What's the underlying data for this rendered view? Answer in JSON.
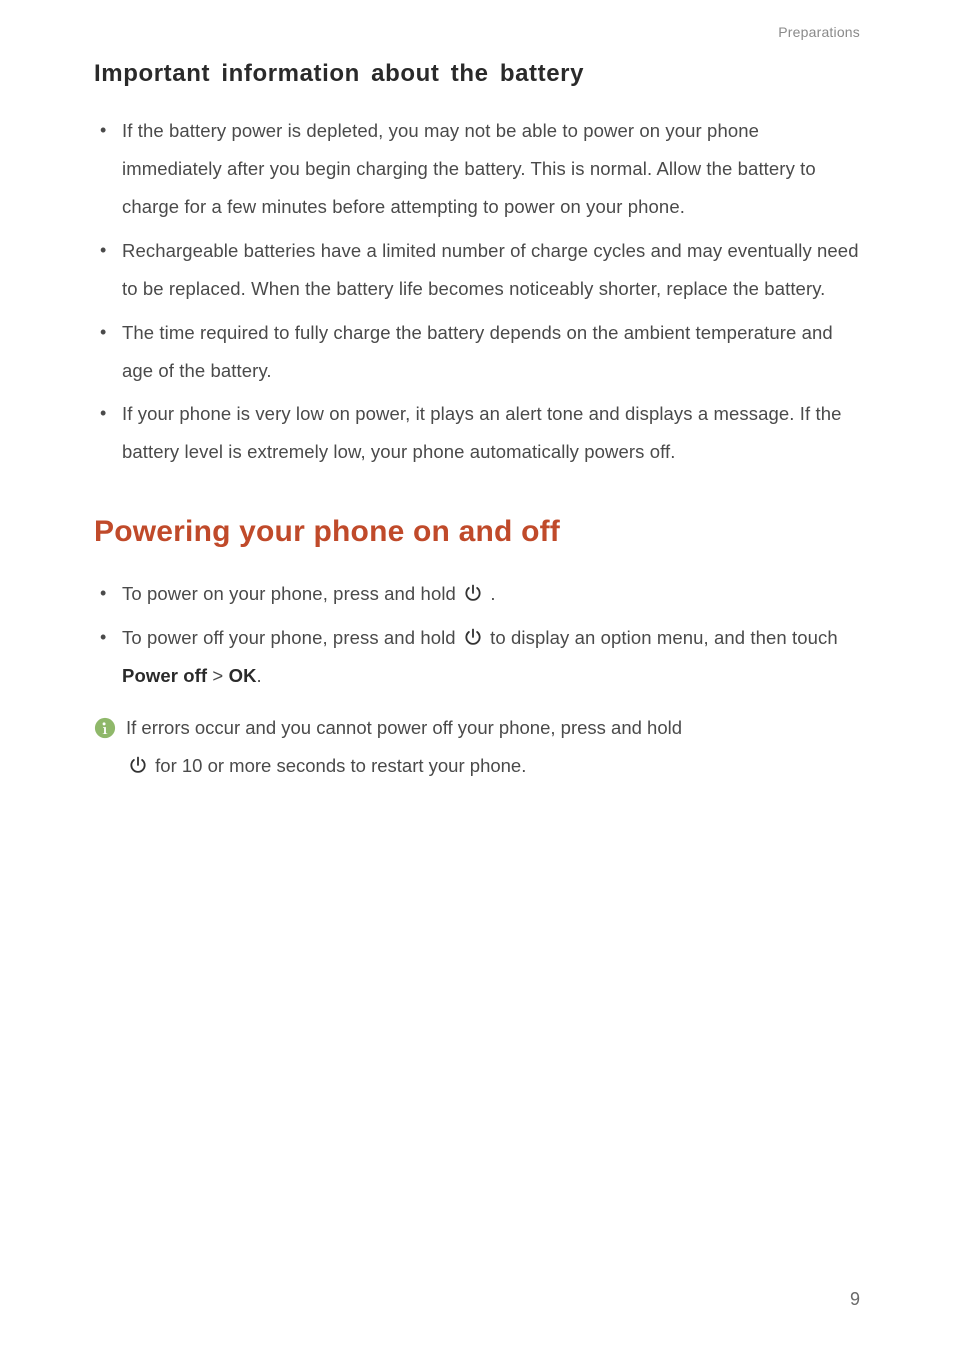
{
  "header": {
    "section_label": "Preparations"
  },
  "heading_sub": "Important information about the battery",
  "bullets_1": [
    "If the battery power is depleted, you may not be able to power on your phone immediately after you begin charging the battery. This is normal. Allow the battery to charge for a few minutes before attempting to power on your phone.",
    "Rechargeable batteries have a limited number of charge cycles and may eventually need to be replaced. When the battery life becomes noticeably shorter, replace the battery.",
    "The time required to fully charge the battery depends on the ambient temperature and age of the battery.",
    "If your phone is very low on power, it plays an alert tone and displays a message. If the battery level is extremely low, your phone automatically powers off."
  ],
  "heading_main": "Powering your phone on and off",
  "bullets_2": {
    "b1_pre": "To power on your phone, press and hold ",
    "b1_post": " .",
    "b2_pre": "To power off your phone, press and hold ",
    "b2_mid": " to display an option menu, and then touch ",
    "b2_bold1": "Power off",
    "b2_sep": " > ",
    "b2_bold2": "OK",
    "b2_post": "."
  },
  "info": {
    "line1": "If errors occur and you cannot power off your phone, press and hold ",
    "line2_post": " for 10 or more seconds to restart your phone."
  },
  "page_number": "9",
  "icons": {
    "power": "power-icon",
    "info": "info-icon"
  }
}
